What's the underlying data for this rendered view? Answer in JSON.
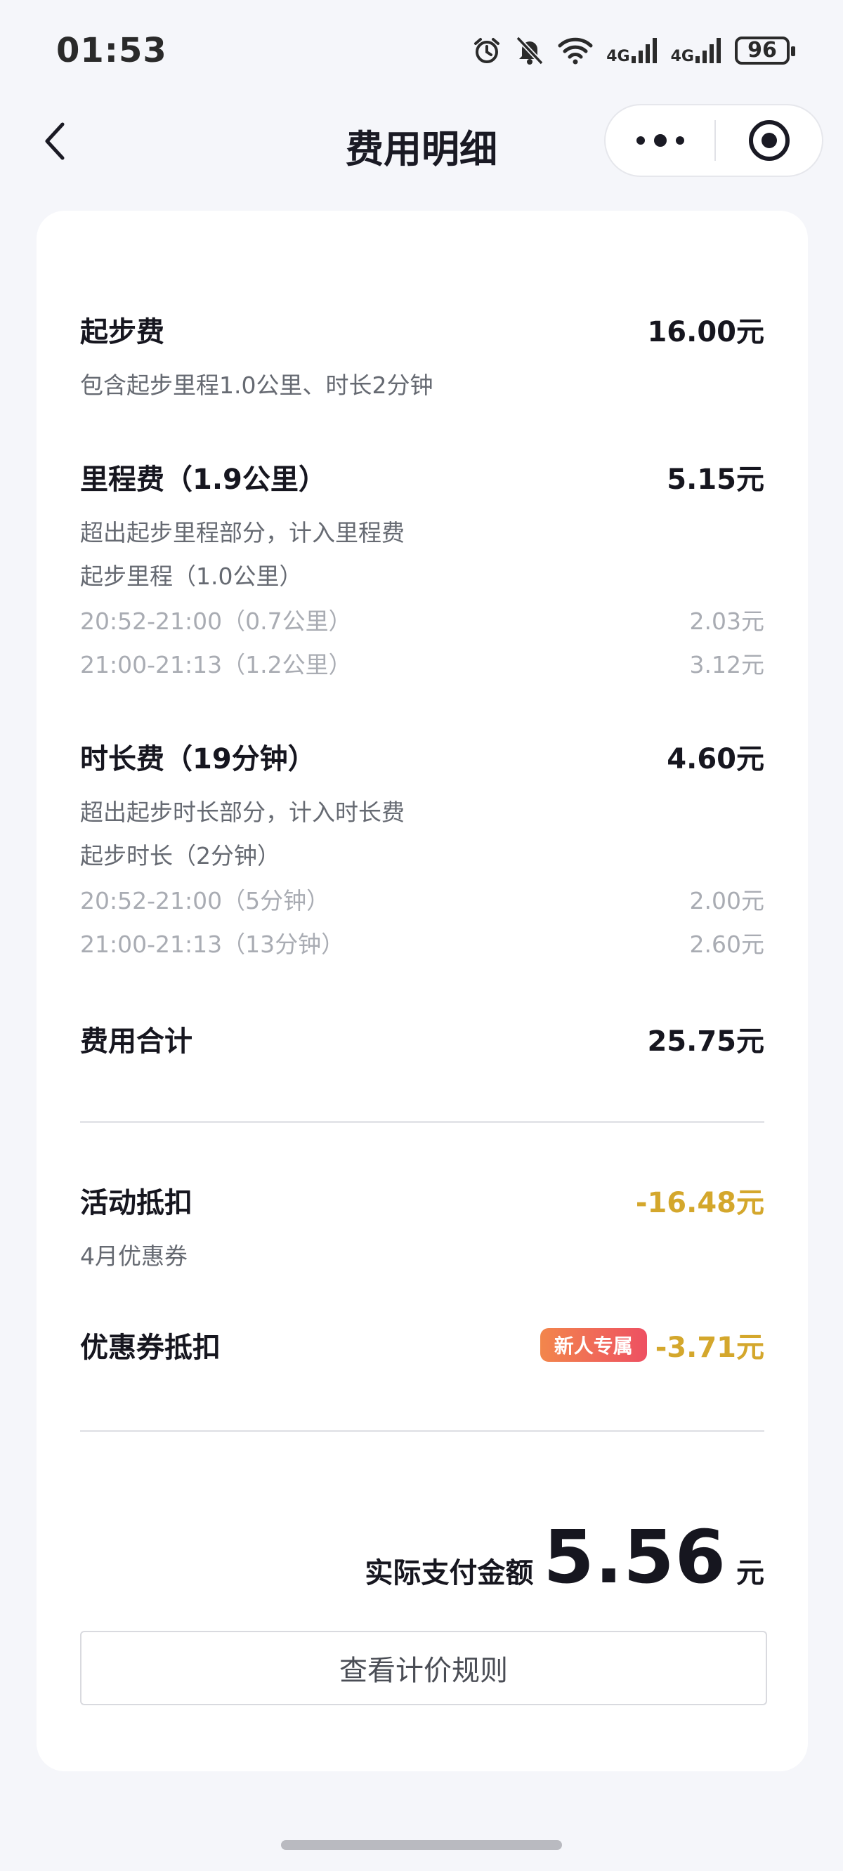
{
  "status_bar": {
    "time": "01:53",
    "network_1": "4G",
    "network_2": "4G",
    "battery": "96"
  },
  "nav": {
    "title": "费用明细"
  },
  "fees": {
    "base": {
      "title": "起步费",
      "amount": "16.00元",
      "desc": "包含起步里程1.0公里、时长2分钟"
    },
    "mileage": {
      "title": "里程费（1.9公里）",
      "amount": "5.15元",
      "desc": "超出起步里程部分，计入里程费",
      "sub": "起步里程（1.0公里）",
      "details": [
        {
          "label": "20:52-21:00（0.7公里）",
          "amount": "2.03元"
        },
        {
          "label": "21:00-21:13（1.2公里）",
          "amount": "3.12元"
        }
      ]
    },
    "duration": {
      "title": "时长费（19分钟）",
      "amount": "4.60元",
      "desc": "超出起步时长部分，计入时长费",
      "sub": "起步时长（2分钟）",
      "details": [
        {
          "label": "20:52-21:00（5分钟）",
          "amount": "2.00元"
        },
        {
          "label": "21:00-21:13（13分钟）",
          "amount": "2.60元"
        }
      ]
    },
    "subtotal": {
      "title": "费用合计",
      "amount": "25.75元"
    }
  },
  "discounts": {
    "activity": {
      "title": "活动抵扣",
      "amount": "-16.48元",
      "desc": "4月优惠券"
    },
    "coupon": {
      "title": "优惠券抵扣",
      "badge": "新人专属",
      "amount": "-3.71元"
    }
  },
  "payment": {
    "label": "实际支付金额",
    "value": "5.56",
    "unit": "元"
  },
  "actions": {
    "rules_button": "查看计价规则"
  },
  "colors": {
    "accent_gold": "#d4a72c",
    "badge_start": "#f2864c",
    "badge_end": "#ee5062"
  }
}
